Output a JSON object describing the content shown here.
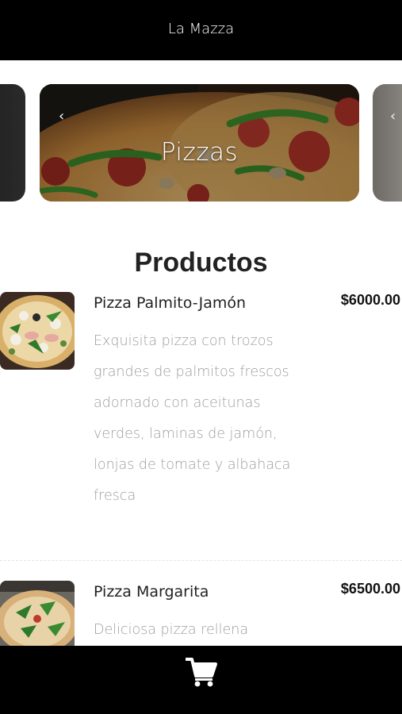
{
  "header": {
    "title": "La Mazza"
  },
  "carousel": {
    "active_label": "Pizzas",
    "prev_glyph": "‹",
    "next_glyph": "‹"
  },
  "section": {
    "title": "Productos"
  },
  "products": [
    {
      "name": "Pizza Palmito-Jamón",
      "price": "$6000.00",
      "description": "Exquisita pizza con trozos grandes de palmitos frescos adornado con aceitunas verdes, laminas de jamón, lonjas de tomate y albahaca fresca"
    },
    {
      "name": "Pizza Margarita",
      "price": "$6500.00",
      "description": "Deliciosa pizza rellena"
    }
  ],
  "footer": {
    "cart_icon": "shopping-cart-icon"
  },
  "colors": {
    "bar": "#000000",
    "text_muted": "#9e9e9e",
    "text_main": "#222222"
  }
}
